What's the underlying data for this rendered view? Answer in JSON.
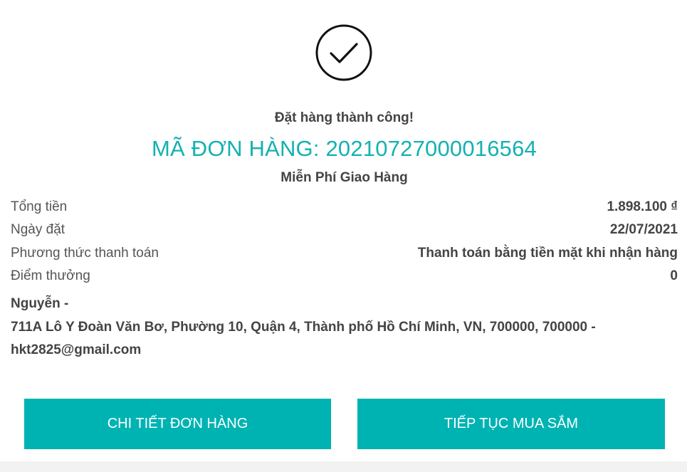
{
  "success": {
    "icon": "check-circle-icon",
    "message": "Đặt hàng thành công!"
  },
  "order": {
    "code_text": "MÃ ĐƠN HÀNG: 20210727000016564",
    "shipping_text": "Miễn Phí Giao Hàng"
  },
  "summary": {
    "total_label": "Tổng tiền",
    "total_value": "1.898.100 ₫",
    "date_label": "Ngày đặt",
    "date_value": "22/07/2021",
    "payment_label": "Phương thức thanh toán",
    "payment_value": "Thanh toán bằng tiền mặt khi nhận hàng",
    "points_label": "Điểm thưởng",
    "points_value": "0"
  },
  "customer": {
    "name": "Nguyễn -",
    "address": "711A Lô Y Đoàn Văn Bơ, Phường 10, Quận 4, Thành phố Hồ Chí Minh, VN, 700000, 700000 -",
    "email": "hkt2825@gmail.com"
  },
  "actions": {
    "detail_label": "CHI TIẾT ĐƠN HÀNG",
    "continue_label": "TIẾP TỤC MUA SẮM"
  },
  "colors": {
    "accent": "#00b3b3",
    "order_code": "#14b1b1"
  }
}
